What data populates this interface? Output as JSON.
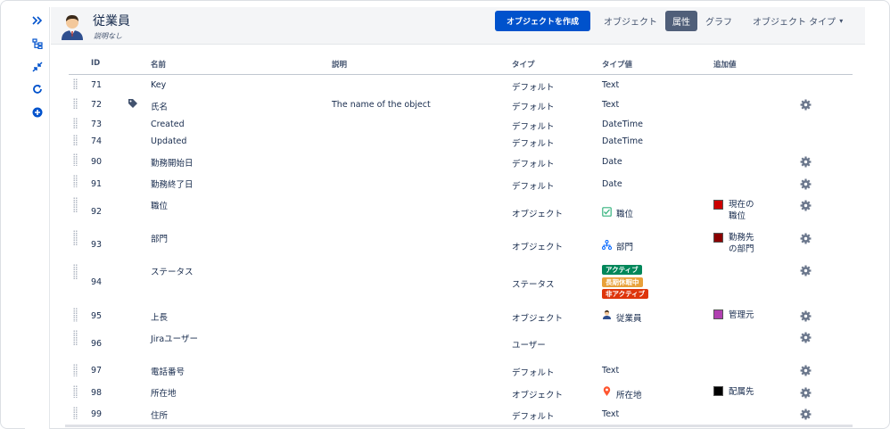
{
  "header": {
    "title": "従業員",
    "description": "説明なし",
    "create_button": "オブジェクトを作成",
    "nav_object": "オブジェクト",
    "nav_attributes": "属性",
    "nav_graph": "グラフ",
    "nav_object_type": "オブジェクト タイプ"
  },
  "columns": {
    "id": "ID",
    "name": "名前",
    "description": "説明",
    "type": "タイプ",
    "type_value": "タイプ値",
    "additional": "追加値"
  },
  "rows": [
    {
      "id": "71",
      "name": "Key",
      "description": "",
      "type": "デフォルト",
      "type_value": "Text",
      "additional": ""
    },
    {
      "id": "72",
      "name": "氏名",
      "description": "The name of the object",
      "type": "デフォルト",
      "type_value": "Text",
      "additional": ""
    },
    {
      "id": "73",
      "name": "Created",
      "description": "",
      "type": "デフォルト",
      "type_value": "DateTime",
      "additional": ""
    },
    {
      "id": "74",
      "name": "Updated",
      "description": "",
      "type": "デフォルト",
      "type_value": "DateTime",
      "additional": ""
    },
    {
      "id": "90",
      "name": "勤務開始日",
      "description": "",
      "type": "デフォルト",
      "type_value": "Date",
      "additional": ""
    },
    {
      "id": "91",
      "name": "勤務終了日",
      "description": "",
      "type": "デフォルト",
      "type_value": "Date",
      "additional": ""
    },
    {
      "id": "92",
      "name": "職位",
      "description": "",
      "type": "オブジェクト",
      "type_value": "職位",
      "additional_line1": "現在の",
      "additional_line2": "職位"
    },
    {
      "id": "93",
      "name": "部門",
      "description": "",
      "type": "オブジェクト",
      "type_value": "部門",
      "additional_line1": "勤務先",
      "additional_line2": "の部門"
    },
    {
      "id": "94",
      "name": "ステータス",
      "description": "",
      "type": "ステータス",
      "status_labels": [
        "アクティブ",
        "長期休暇中",
        "非アクティブ"
      ]
    },
    {
      "id": "95",
      "name": "上長",
      "description": "",
      "type": "オブジェクト",
      "type_value": "従業員",
      "additional": "管理元"
    },
    {
      "id": "96",
      "name": "Jiraユーザー",
      "description": "",
      "type": "ユーザー",
      "type_value": "",
      "additional": ""
    },
    {
      "id": "97",
      "name": "電話番号",
      "description": "",
      "type": "デフォルト",
      "type_value": "Text",
      "additional": ""
    },
    {
      "id": "98",
      "name": "所在地",
      "description": "",
      "type": "オブジェクト",
      "type_value": "所在地",
      "additional": "配属先"
    },
    {
      "id": "99",
      "name": "住所",
      "description": "",
      "type": "デフォルト",
      "type_value": "Text",
      "additional": ""
    }
  ],
  "colors": {
    "primary": "#0052cc",
    "active_nav": "#505f79",
    "status_active": "#00875a",
    "status_leave": "#e8a13a",
    "status_inactive": "#de350b",
    "swatch_position": "#cc0000",
    "swatch_department": "#8b0000",
    "swatch_manager": "#b040b0",
    "swatch_location": "#000000"
  },
  "icons": {
    "rail": [
      "expand-icon",
      "hierarchy-icon",
      "collapse-icon",
      "refresh-icon",
      "add-icon"
    ],
    "row_settings": "gear-icon",
    "label": "tag-icon",
    "position": "checkbox-icon",
    "department": "org-chart-icon",
    "employee": "person-icon",
    "location": "map-pin-icon"
  }
}
